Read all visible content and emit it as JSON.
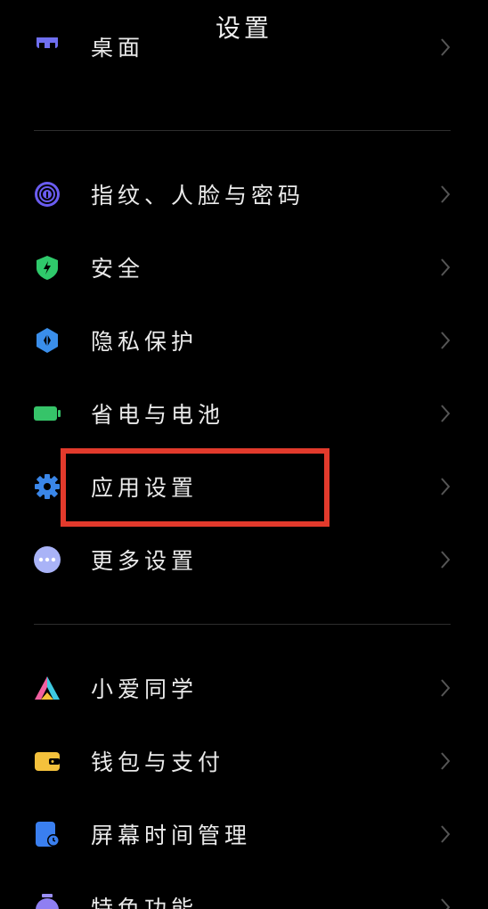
{
  "header": {
    "title": "设置"
  },
  "partial_top": {
    "label": "桌面"
  },
  "group1": [
    {
      "label": "指纹、人脸与密码",
      "icon": "fingerprint-icon"
    },
    {
      "label": "安全",
      "icon": "shield-icon"
    },
    {
      "label": "隐私保护",
      "icon": "privacy-icon"
    },
    {
      "label": "省电与电池",
      "icon": "battery-icon"
    },
    {
      "label": "应用设置",
      "icon": "gear-icon"
    },
    {
      "label": "更多设置",
      "icon": "more-icon"
    }
  ],
  "group2": [
    {
      "label": "小爱同学",
      "icon": "xiaoai-icon"
    },
    {
      "label": "钱包与支付",
      "icon": "wallet-icon"
    },
    {
      "label": "屏幕时间管理",
      "icon": "screen-time-icon"
    }
  ],
  "partial_bottom": {
    "label": "特色功能"
  },
  "colors": {
    "background": "#000000",
    "highlight": "#e23a2c",
    "shield": "#2fc96b",
    "privacy": "#3a8eea",
    "battery": "#36c469",
    "gear": "#3a86e8",
    "more": "#a9b3f7",
    "wallet": "#f4c13c",
    "screen_time": "#3a7ff0"
  }
}
